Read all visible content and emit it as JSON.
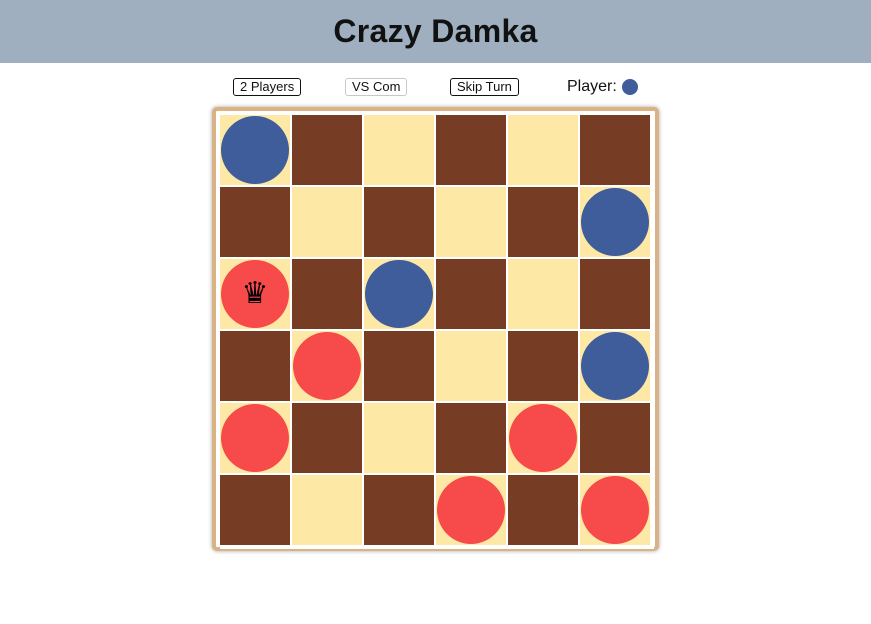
{
  "header": {
    "title": "Crazy Damka"
  },
  "controls": {
    "two_players_label": "2 Players",
    "vs_com_label": "VS Com",
    "skip_turn_label": "Skip Turn",
    "player_label": "Player:",
    "current_player": "blue"
  },
  "colors": {
    "light_square": "#fde8a6",
    "dark_square": "#773c24",
    "blue_piece": "#3e5d9a",
    "red_piece": "#f74a4a",
    "header_bg": "#9fafc0",
    "board_border": "#d9b383"
  },
  "board": {
    "rows": [
      [
        {
          "square": "light",
          "piece": "blue"
        },
        {
          "square": "dark",
          "piece": null
        },
        {
          "square": "light",
          "piece": null
        },
        {
          "square": "dark",
          "piece": null
        },
        {
          "square": "light",
          "piece": null
        },
        {
          "square": "dark",
          "piece": null
        }
      ],
      [
        {
          "square": "dark",
          "piece": null
        },
        {
          "square": "light",
          "piece": null
        },
        {
          "square": "dark",
          "piece": null
        },
        {
          "square": "light",
          "piece": null
        },
        {
          "square": "dark",
          "piece": null
        },
        {
          "square": "light",
          "piece": "blue"
        }
      ],
      [
        {
          "square": "light",
          "piece": "red",
          "king": true
        },
        {
          "square": "dark",
          "piece": null
        },
        {
          "square": "light",
          "piece": "blue"
        },
        {
          "square": "dark",
          "piece": null
        },
        {
          "square": "light",
          "piece": null
        },
        {
          "square": "dark",
          "piece": null
        }
      ],
      [
        {
          "square": "dark",
          "piece": null
        },
        {
          "square": "light",
          "piece": "red"
        },
        {
          "square": "dark",
          "piece": null
        },
        {
          "square": "light",
          "piece": null
        },
        {
          "square": "dark",
          "piece": null
        },
        {
          "square": "light",
          "piece": "blue"
        }
      ],
      [
        {
          "square": "light",
          "piece": "red"
        },
        {
          "square": "dark",
          "piece": null
        },
        {
          "square": "light",
          "piece": null
        },
        {
          "square": "dark",
          "piece": null
        },
        {
          "square": "light",
          "piece": "red"
        },
        {
          "square": "dark",
          "piece": null
        }
      ],
      [
        {
          "square": "dark",
          "piece": null
        },
        {
          "square": "light",
          "piece": null
        },
        {
          "square": "dark",
          "piece": null
        },
        {
          "square": "light",
          "piece": "red"
        },
        {
          "square": "dark",
          "piece": null
        },
        {
          "square": "light",
          "piece": "red"
        }
      ]
    ],
    "king_icon": "queen-crown-icon",
    "king_glyph": "♛"
  }
}
